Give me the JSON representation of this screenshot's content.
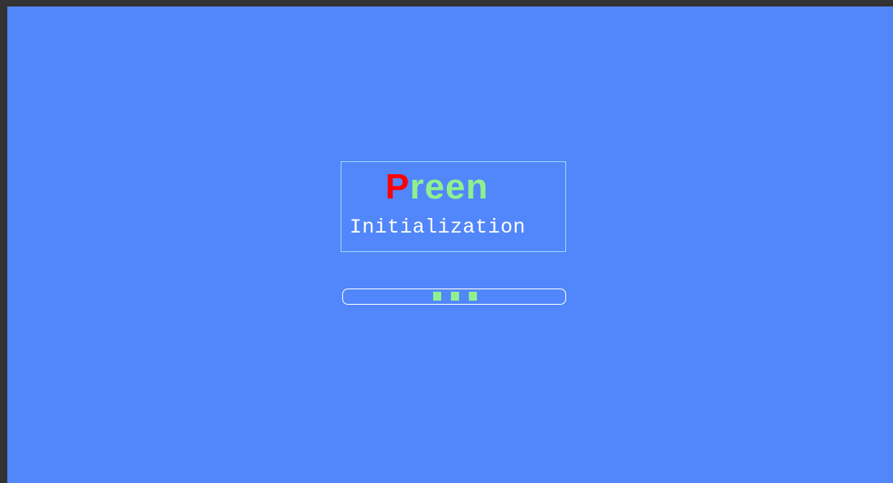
{
  "splash": {
    "brand_first_letter": "P",
    "brand_rest": "reen",
    "subtitle": "Initialization"
  },
  "progress": {
    "style": "indeterminate",
    "block_count": 3
  },
  "colors": {
    "background": "#5286fb",
    "frame": "#333333",
    "brand_first_letter": "#ff0000",
    "brand_rest": "#8ef08e",
    "subtitle": "#ffffff",
    "progress_blocks": "#8ef08e",
    "box_border": "#9fd8ff"
  }
}
